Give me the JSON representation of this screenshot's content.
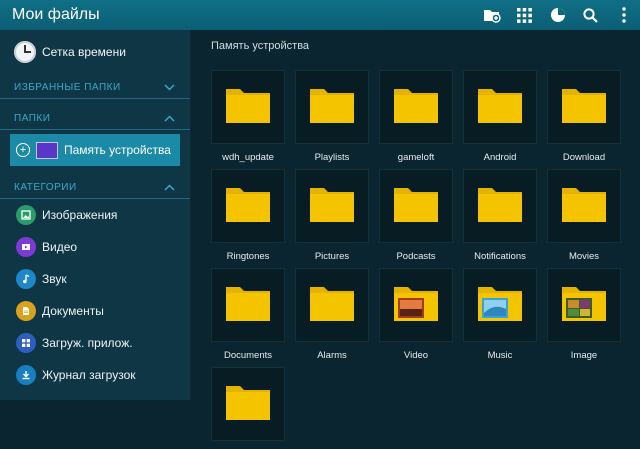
{
  "app": {
    "title": "Мои файлы"
  },
  "toolbar": {
    "icons": [
      "new-folder-icon",
      "grid-view-icon",
      "storage-usage-icon",
      "search-icon",
      "more-vert-icon"
    ]
  },
  "sidebar": {
    "timeline": {
      "label": "Сетка времени",
      "icon": "clock-icon"
    },
    "favorites": {
      "header": "ИЗБРАННЫЕ ПАПКИ",
      "collapsed": true
    },
    "folders": {
      "header": "ПАПКИ",
      "items": [
        {
          "label": "Память устройства",
          "selected": true
        }
      ]
    },
    "categories": {
      "header": "КАТЕГОРИИ",
      "items": [
        {
          "label": "Изображения",
          "icon": "images-icon",
          "color": "#2a9b6a"
        },
        {
          "label": "Видео",
          "icon": "video-icon",
          "color": "#7c3bd4"
        },
        {
          "label": "Звук",
          "icon": "music-icon",
          "color": "#1d87c9"
        },
        {
          "label": "Документы",
          "icon": "documents-icon",
          "color": "#d8a21c"
        },
        {
          "label": "Загруж. прилож.",
          "icon": "apps-icon",
          "color": "#2d5fc1"
        },
        {
          "label": "Журнал загрузок",
          "icon": "download-icon",
          "color": "#1a7fc0"
        }
      ]
    }
  },
  "main": {
    "path": "Память устройства",
    "folders": [
      {
        "name": "wdh_update",
        "preview": "folder"
      },
      {
        "name": "Playlists",
        "preview": "folder"
      },
      {
        "name": "gameloft",
        "preview": "folder"
      },
      {
        "name": "Android",
        "preview": "folder"
      },
      {
        "name": "Download",
        "preview": "folder"
      },
      {
        "name": "Ringtones",
        "preview": "folder"
      },
      {
        "name": "Pictures",
        "preview": "folder"
      },
      {
        "name": "Podcasts",
        "preview": "folder"
      },
      {
        "name": "Notifications",
        "preview": "folder"
      },
      {
        "name": "Movies",
        "preview": "folder"
      },
      {
        "name": "Documents",
        "preview": "folder"
      },
      {
        "name": "Alarms",
        "preview": "folder"
      },
      {
        "name": "Video",
        "preview": "folder-video"
      },
      {
        "name": "Music",
        "preview": "folder-music"
      },
      {
        "name": "Image",
        "preview": "folder-image"
      },
      {
        "name": "",
        "preview": "folder"
      }
    ]
  },
  "colors": {
    "accent": "#1b8aa7",
    "folder": "#f5c400",
    "folder_tab": "#e6b200",
    "section_header": "#3aa8cc"
  }
}
